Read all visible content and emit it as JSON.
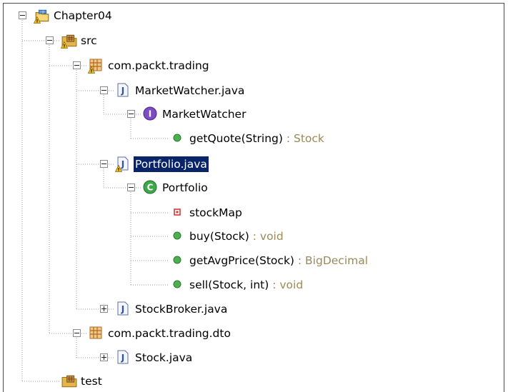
{
  "tree": {
    "nodes": [
      {
        "id": "chapter04",
        "label": "Chapter04",
        "icon": "project-icon",
        "expander": "expanded",
        "warning": true
      },
      {
        "id": "src",
        "label": "src",
        "icon": "source-folder-icon",
        "expander": "expanded",
        "warning": true
      },
      {
        "id": "pkg-trading",
        "label": "com.packt.trading",
        "icon": "package-icon",
        "expander": "expanded",
        "warning": true
      },
      {
        "id": "marketwatcher-java",
        "label": "MarketWatcher.java",
        "icon": "java-file-icon",
        "expander": "expanded"
      },
      {
        "id": "marketwatcher-iface",
        "label": "MarketWatcher",
        "icon": "interface-icon",
        "expander": "expanded"
      },
      {
        "id": "getquote",
        "label": "getQuote(String)",
        "return_type": " : Stock",
        "icon": "public-method-icon"
      },
      {
        "id": "portfolio-java",
        "label": "Portfolio.java",
        "icon": "java-file-icon",
        "expander": "expanded",
        "warning": true,
        "selected": true
      },
      {
        "id": "portfolio-class",
        "label": "Portfolio",
        "icon": "class-icon",
        "expander": "expanded"
      },
      {
        "id": "stockmap",
        "label": "stockMap",
        "icon": "private-field-icon"
      },
      {
        "id": "buy",
        "label": "buy(Stock)",
        "return_type": " : void",
        "icon": "public-method-icon"
      },
      {
        "id": "getavgprice",
        "label": "getAvgPrice(Stock)",
        "return_type": " : BigDecimal",
        "icon": "public-method-icon"
      },
      {
        "id": "sell",
        "label": "sell(Stock, int)",
        "return_type": " : void",
        "icon": "public-method-icon"
      },
      {
        "id": "stockbroker-java",
        "label": "StockBroker.java",
        "icon": "java-file-icon",
        "expander": "collapsed"
      },
      {
        "id": "pkg-dto",
        "label": "com.packt.trading.dto",
        "icon": "package-icon",
        "expander": "expanded"
      },
      {
        "id": "stock-java",
        "label": "Stock.java",
        "icon": "java-file-icon",
        "expander": "collapsed"
      },
      {
        "id": "test",
        "label": "test",
        "icon": "source-folder-icon"
      }
    ]
  }
}
